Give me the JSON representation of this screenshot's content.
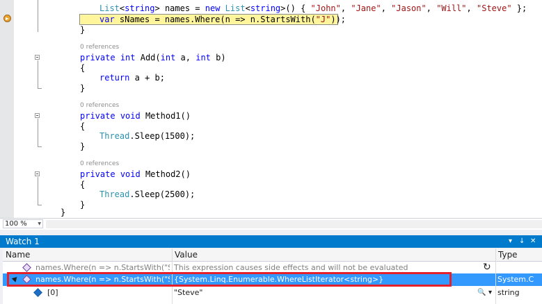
{
  "editor": {
    "code_lines": {
      "names_decl": {
        "type1": "List",
        "lt1": "<",
        "kw_string1": "string",
        "gt1": "> names = ",
        "kw_new": "new",
        "sp": " ",
        "type2": "List",
        "lt2": "<",
        "kw_string2": "string",
        "gt2": ">() { ",
        "s1": "\"John\"",
        "c1": ", ",
        "s2": "\"Jane\"",
        "c2": ", ",
        "s3": "\"Jason\"",
        "c3": ", ",
        "s4": "\"Will\"",
        "c4": ", ",
        "s5": "\"Steve\"",
        "end": " };"
      },
      "snames_decl": {
        "kw_var": "var",
        "mid": " sNames = names.Where(n => n.StartsWith(",
        "str": "\"J\"",
        "end": "));"
      },
      "close1": "}",
      "lens1": "0 references",
      "add_sig": {
        "kw_private": "private",
        "kw_int": "int",
        "name": " Add(",
        "kw_int2": "int",
        "p1": " a, ",
        "kw_int3": "int",
        "p2": " b)"
      },
      "open2": "{",
      "return_line": {
        "kw_return": "return",
        "rest": " a + b;"
      },
      "close2": "}",
      "lens2": "0 references",
      "m1_sig": {
        "kw_private": "private",
        "kw_void": "void",
        "rest": " Method1()"
      },
      "open3": "{",
      "m1_body": {
        "type": "Thread",
        "rest": ".Sleep(1500);"
      },
      "close3": "}",
      "lens3": "0 references",
      "m2_sig": {
        "kw_private": "private",
        "kw_void": "void",
        "rest": " Method2()"
      },
      "open4": "{",
      "m2_body": {
        "type": "Thread",
        "rest": ".Sleep(2500);"
      },
      "close4": "}",
      "close_class": "}"
    },
    "zoom": "100 %"
  },
  "watch": {
    "title": "Watch 1",
    "pin_icon": "▾",
    "pin2_icon": "↓",
    "close_icon": "✕",
    "columns": {
      "name": "Name",
      "value": "Value",
      "type": "Type"
    },
    "rows": [
      {
        "name": "names.Where(n => n.StartsWith(\"S\"))",
        "value": "This expression causes side effects and will not be evaluated",
        "type": ""
      },
      {
        "name": "names.Where(n => n.StartsWith(\"S\"))",
        "value": "{System.Linq.Enumerable.WhereListIterator<string>}",
        "type": "System.C"
      },
      {
        "name": "[0]",
        "value": "\"Steve\"",
        "type": "string"
      }
    ],
    "refresh_icon": "↻",
    "search_icon": "🔍",
    "dropdown_icon": "▾"
  },
  "colors": {
    "accent": "#007acc",
    "selection": "#3399ff",
    "highlight": "#fff59d",
    "annotation_red": "#e4212b"
  }
}
